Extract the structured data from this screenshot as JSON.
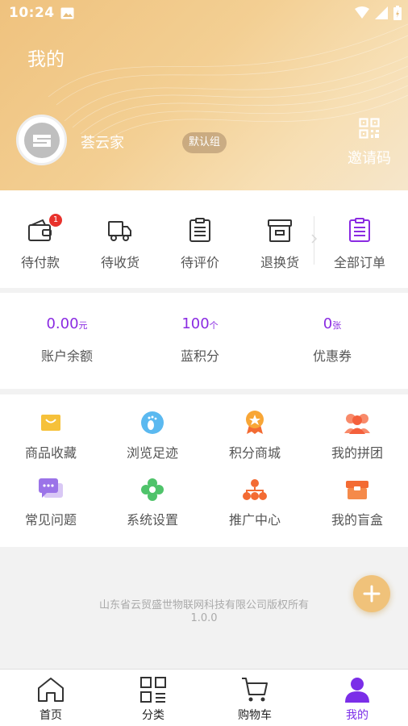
{
  "status_bar": {
    "time": "10:24"
  },
  "header": {
    "title": "我的",
    "user_name": "荟云家",
    "group_badge": "默认组",
    "invite_label": "邀请码"
  },
  "orders": [
    {
      "label": "待付款",
      "icon": "wallet-icon",
      "badge": "1"
    },
    {
      "label": "待收货",
      "icon": "truck-icon"
    },
    {
      "label": "待评价",
      "icon": "clipboard-icon"
    },
    {
      "label": "退换货",
      "icon": "archive-box-icon"
    },
    {
      "label": "全部订单",
      "icon": "order-list-icon"
    }
  ],
  "assets": [
    {
      "value": "0.00",
      "unit": "元",
      "label": "账户余额"
    },
    {
      "value": "100",
      "unit": "个",
      "label": "蓝积分"
    },
    {
      "value": "0",
      "unit": "张",
      "label": "优惠券"
    }
  ],
  "tools": [
    {
      "label": "商品收藏",
      "icon": "favorites-bag-icon"
    },
    {
      "label": "浏览足迹",
      "icon": "footprint-icon"
    },
    {
      "label": "积分商城",
      "icon": "medal-icon"
    },
    {
      "label": "我的拼团",
      "icon": "group-users-icon"
    },
    {
      "label": "常见问题",
      "icon": "chat-bubbles-icon"
    },
    {
      "label": "系统设置",
      "icon": "flower-settings-icon"
    },
    {
      "label": "推广中心",
      "icon": "hierarchy-icon"
    },
    {
      "label": "我的盲盒",
      "icon": "blind-box-icon"
    }
  ],
  "footer": {
    "copyright": "山东省云贸盛世物联网科技有限公司版权所有",
    "version": "1.0.0"
  },
  "tabbar": [
    {
      "label": "首页",
      "icon": "home-icon"
    },
    {
      "label": "分类",
      "icon": "category-grid-icon"
    },
    {
      "label": "购物车",
      "icon": "cart-icon"
    },
    {
      "label": "我的",
      "icon": "user-icon",
      "active": true
    }
  ],
  "colors": {
    "accent": "#7b2ee8",
    "header_gold": "#efc27e",
    "badge_red": "#e8322c",
    "fab": "#f0c27a"
  }
}
